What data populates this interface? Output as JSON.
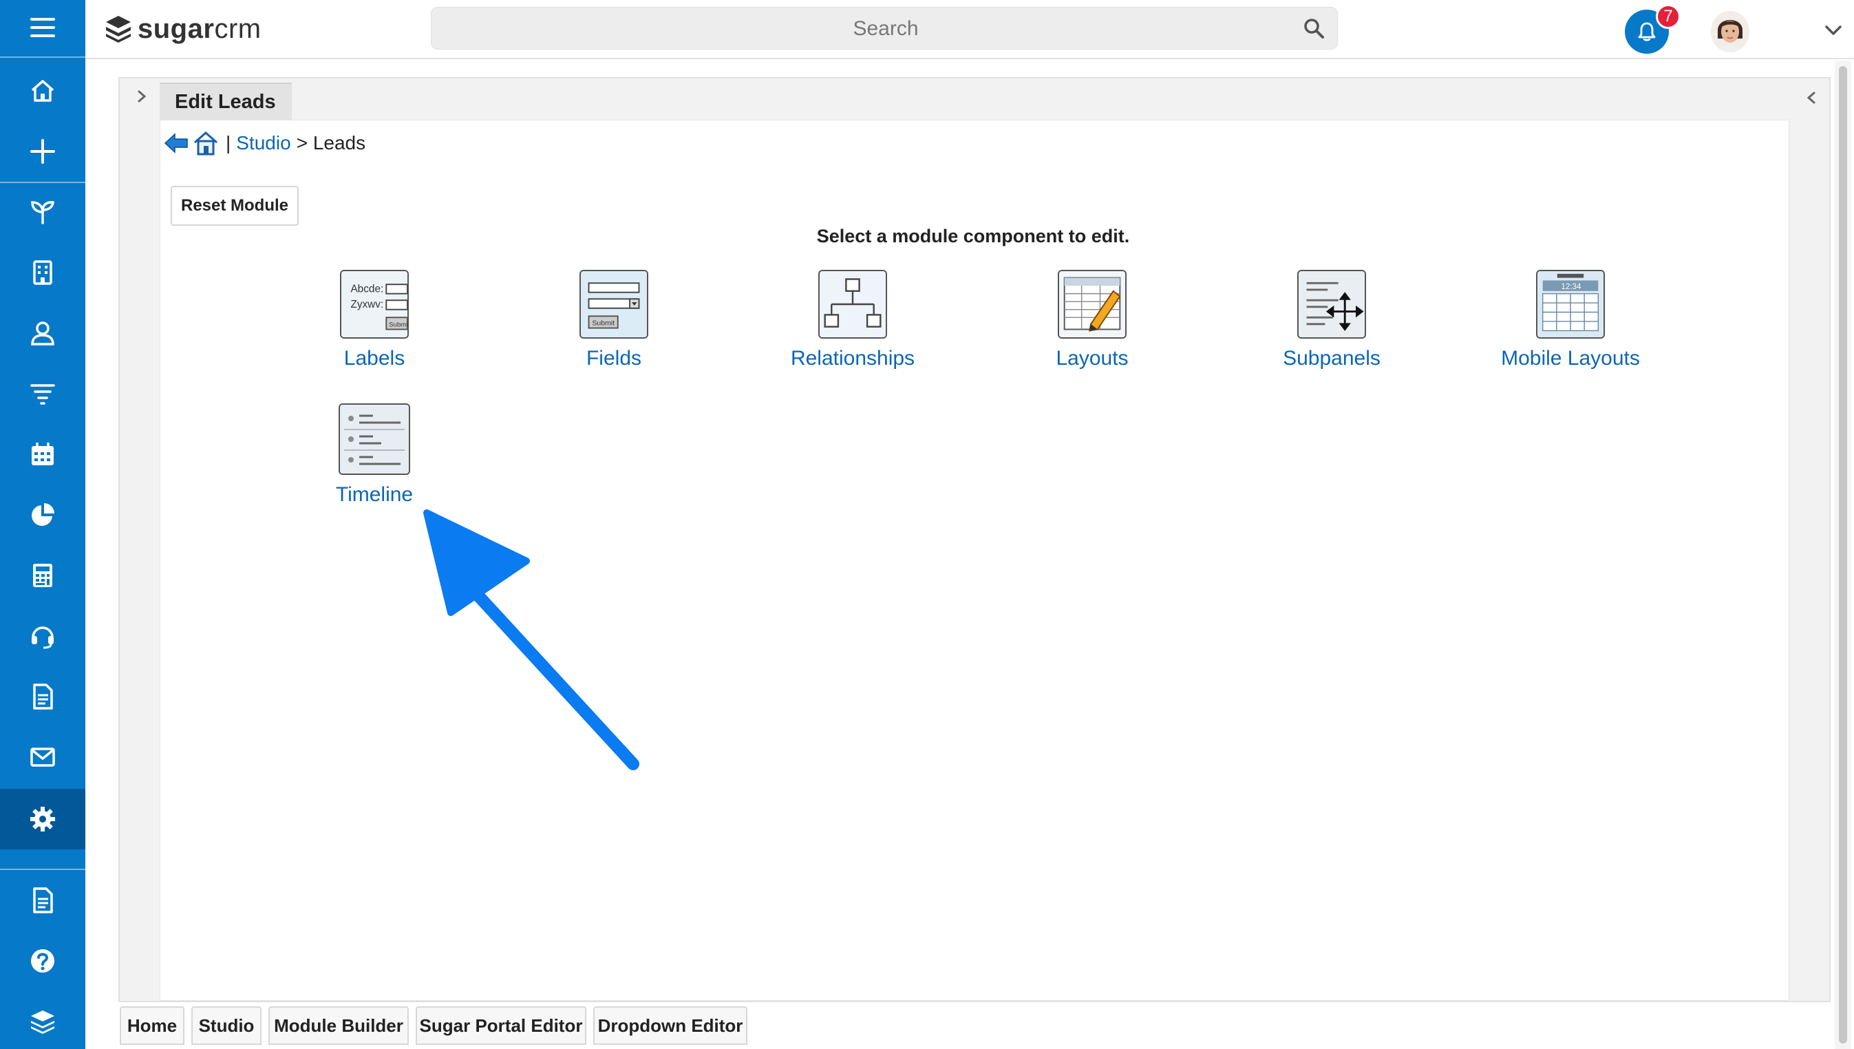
{
  "header": {
    "logo_sugar": "sugar",
    "logo_crm": "crm",
    "search_placeholder": "Search",
    "notification_count": "7"
  },
  "rail": {
    "items": [
      "menu-icon",
      "home-icon",
      "plus-icon",
      "sprout-icon",
      "building-icon",
      "user-icon",
      "funnel-icon",
      "calendar-icon",
      "pie-chart-icon",
      "calculator-icon",
      "headset-icon",
      "document-icon",
      "mail-icon",
      "gear-icon",
      "document-icon",
      "help-icon",
      "layers-icon"
    ],
    "active": "gear-icon"
  },
  "panel": {
    "tab_title": "Edit Leads",
    "breadcrumb_sep": "|",
    "breadcrumb_link": "Studio",
    "breadcrumb_rest": "> Leads",
    "reset_button": "Reset Module",
    "prompt": "Select a module component to edit."
  },
  "components": [
    {
      "label": "Labels",
      "icon": "labels-icon"
    },
    {
      "label": "Fields",
      "icon": "fields-icon"
    },
    {
      "label": "Relationships",
      "icon": "relationships-icon"
    },
    {
      "label": "Layouts",
      "icon": "layouts-icon"
    },
    {
      "label": "Subpanels",
      "icon": "subpanels-icon"
    },
    {
      "label": "Mobile Layouts",
      "icon": "mobile-layouts-icon"
    },
    {
      "label": "Timeline",
      "icon": "timeline-icon"
    }
  ],
  "icon_text": {
    "labels_line1": "Abcde:",
    "labels_line2": "Zyxwv:",
    "submit": "Submit",
    "mobile_time": "12:34"
  },
  "bottom_tabs": [
    "Home",
    "Studio",
    "Module Builder",
    "Sugar Portal Editor",
    "Dropdown Editor"
  ],
  "colors": {
    "brand_blue": "#0679c8",
    "link_blue": "#0b66b7",
    "annotation_arrow": "#0a7bf0",
    "badge_red": "#e3213b"
  }
}
